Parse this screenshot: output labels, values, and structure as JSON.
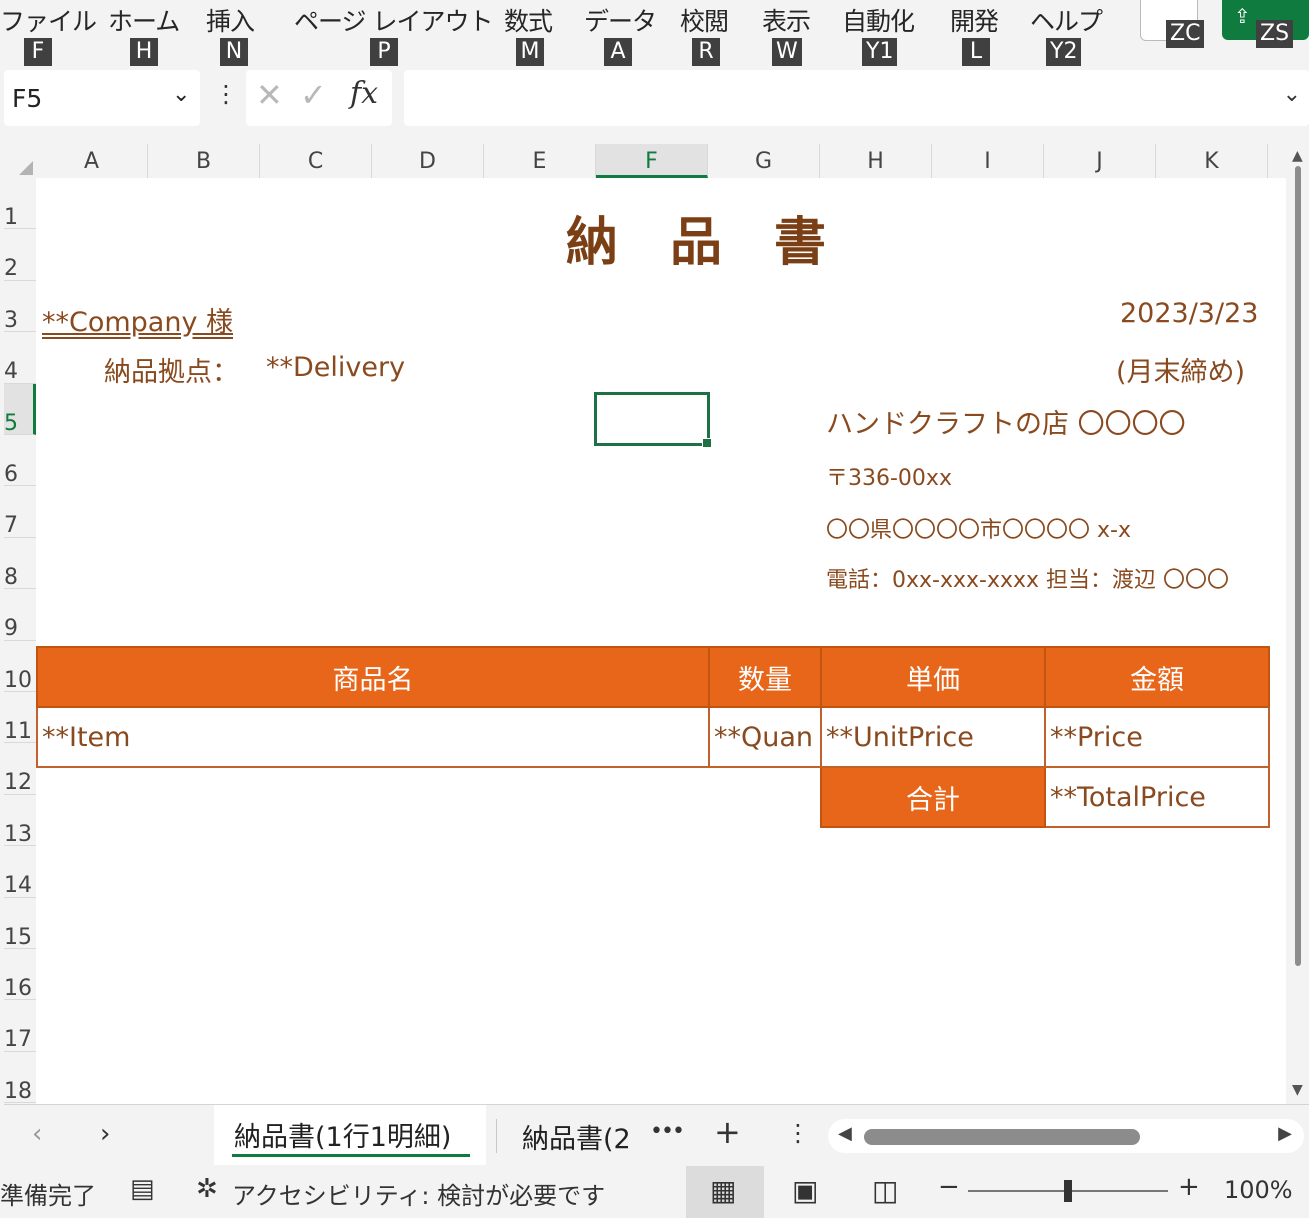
{
  "ribbon": {
    "tabs": [
      {
        "label": "ファイル",
        "key": "F"
      },
      {
        "label": "ホーム",
        "key": "H"
      },
      {
        "label": "挿入",
        "key": "N"
      },
      {
        "label": "ページ レイアウト",
        "key": "P"
      },
      {
        "label": "数式",
        "key": "M"
      },
      {
        "label": "データ",
        "key": "A"
      },
      {
        "label": "校閲",
        "key": "R"
      },
      {
        "label": "表示",
        "key": "W"
      },
      {
        "label": "自動化",
        "key": "Y1"
      },
      {
        "label": "開発",
        "key": "L"
      },
      {
        "label": "ヘルプ",
        "key": "Y2"
      }
    ],
    "extra_keys": [
      "ZC",
      "ZS"
    ]
  },
  "formula_bar": {
    "name_box": "F5",
    "cancel_glyph": "✕",
    "enter_glyph": "✓",
    "fx_glyph": "fx",
    "formula": ""
  },
  "columns": [
    "A",
    "B",
    "C",
    "D",
    "E",
    "F",
    "G",
    "H",
    "I",
    "J",
    "K"
  ],
  "selected_column": "F",
  "rows": [
    "1",
    "2",
    "3",
    "4",
    "5",
    "6",
    "7",
    "8",
    "9",
    "10",
    "11",
    "12",
    "13",
    "14",
    "15",
    "16",
    "17",
    "18"
  ],
  "selected_row": "5",
  "sheet": {
    "title": "納品書",
    "company": "**Company 様",
    "delivery_label": "納品拠点：",
    "delivery_value": "**Delivery",
    "date": "2023/3/23",
    "closing": "(月末締め)",
    "shop_name": "ハンドクラフトの店 〇〇〇〇",
    "postal": "〒336-00xx",
    "address": "〇〇県〇〇〇〇市〇〇〇〇 x-x",
    "phone": "電話：0xx-xxx-xxxx 担当：渡辺 〇〇〇",
    "table_headers": [
      "商品名",
      "数量",
      "単価",
      "金額"
    ],
    "item_row": [
      "**Item",
      "**Quan",
      "**UnitPrice",
      "**Price"
    ],
    "total_label": "合計",
    "total_value": "**TotalPrice"
  },
  "sheet_tabs": {
    "active": "納品書(1行1明細)",
    "second": "納品書(2",
    "more": "•••",
    "add": "+",
    "menu": "⋮"
  },
  "status": {
    "ready": "準備完了",
    "accessibility": "アクセシビリティ: 検討が必要です",
    "zoom": "100%",
    "zoom_minus": "−",
    "zoom_plus": "+"
  },
  "colors": {
    "accent_green": "#0f7b3e",
    "header_orange": "#e8661a",
    "text_brown": "#7b3f16"
  }
}
